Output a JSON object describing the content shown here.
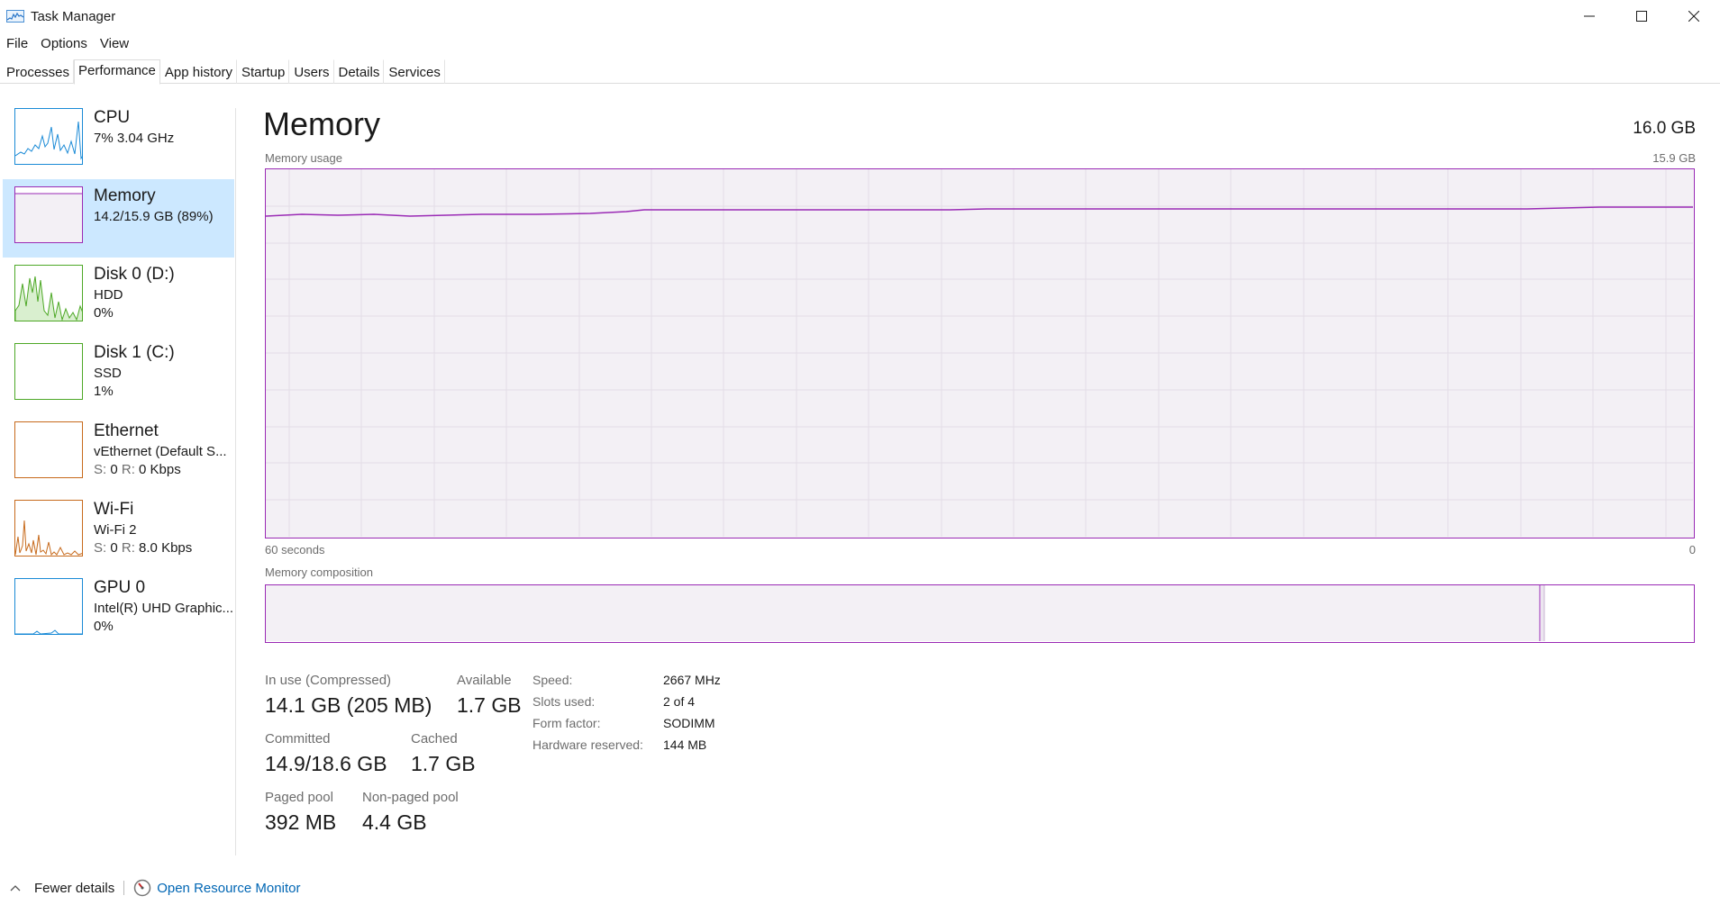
{
  "window": {
    "title": "Task Manager"
  },
  "menu": [
    "File",
    "Options",
    "View"
  ],
  "tabs": [
    "Processes",
    "Performance",
    "App history",
    "Startup",
    "Users",
    "Details",
    "Services"
  ],
  "active_tab": "Performance",
  "sidebar": [
    {
      "name": "CPU",
      "line2": "7% 3.04 GHz",
      "line3": "",
      "color": "#1a8ad6"
    },
    {
      "name": "Memory",
      "line2": "14.2/15.9 GB (89%)",
      "line3": "",
      "color": "#9a2ab5"
    },
    {
      "name": "Disk 0 (D:)",
      "line2": "HDD",
      "line3": "0%",
      "color": "#4da826"
    },
    {
      "name": "Disk 1 (C:)",
      "line2": "SSD",
      "line3": "1%",
      "color": "#4da826"
    },
    {
      "name": "Ethernet",
      "line2": "vEthernet (Default S...",
      "line3_s_label": "S:",
      "line3_s_value": "0",
      "line3_r_label": "R:",
      "line3_r_value": "0 Kbps",
      "color": "#c76a1c"
    },
    {
      "name": "Wi-Fi",
      "line2": "Wi-Fi 2",
      "line3_s_label": "S:",
      "line3_s_value": "0",
      "line3_r_label": "R:",
      "line3_r_value": "8.0 Kbps",
      "color": "#c76a1c"
    },
    {
      "name": "GPU 0",
      "line2": "Intel(R) UHD Graphic...",
      "line3": "0%",
      "color": "#1a8ad6"
    }
  ],
  "main": {
    "title": "Memory",
    "total": "16.0 GB",
    "usage_label": "Memory usage",
    "usage_max": "15.9 GB",
    "time_left": "60 seconds",
    "time_right": "0",
    "composition_label": "Memory composition",
    "in_use_label": "In use (Compressed)",
    "in_use_value": "14.1 GB (205 MB)",
    "available_label": "Available",
    "available_value": "1.7 GB",
    "committed_label": "Committed",
    "committed_value": "14.9/18.6 GB",
    "cached_label": "Cached",
    "cached_value": "1.7 GB",
    "paged_label": "Paged pool",
    "paged_value": "392 MB",
    "nonpaged_label": "Non-paged pool",
    "nonpaged_value": "4.4 GB",
    "specs": [
      {
        "label": "Speed:",
        "value": "2667 MHz"
      },
      {
        "label": "Slots used:",
        "value": "2 of 4"
      },
      {
        "label": "Form factor:",
        "value": "SODIMM"
      },
      {
        "label": "Hardware reserved:",
        "value": "144 MB"
      }
    ]
  },
  "footer": {
    "fewer_details": "Fewer details",
    "open_resource_monitor": "Open Resource Monitor"
  },
  "colors": {
    "memory_accent": "#9a2ab5",
    "selection": "#cce8ff",
    "link": "#0066b4"
  }
}
